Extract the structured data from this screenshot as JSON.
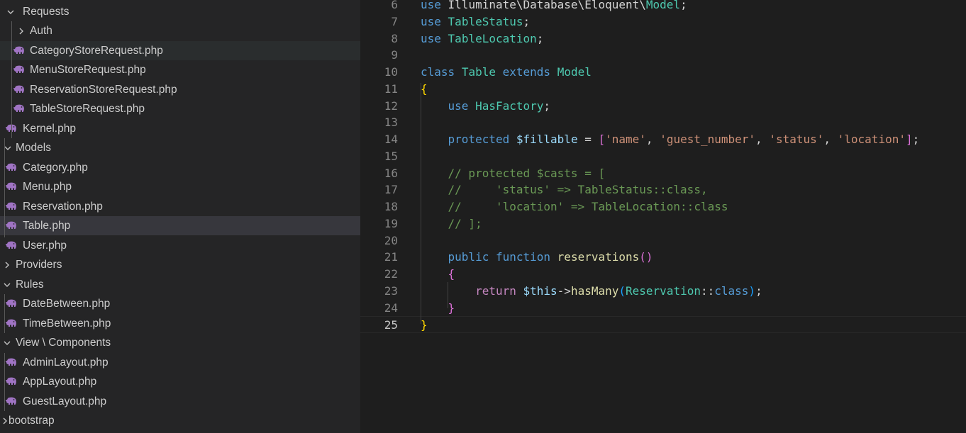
{
  "explorer": {
    "items": [
      {
        "label": "Requests",
        "type": "folder",
        "expanded": true,
        "icon": "chevron-down-icon"
      },
      {
        "label": "Auth",
        "type": "folder",
        "expanded": false,
        "icon": "chevron-right-icon"
      },
      {
        "label": "CategoryStoreRequest.php",
        "type": "file",
        "icon": "php-elephant-icon",
        "state": "hover"
      },
      {
        "label": "MenuStoreRequest.php",
        "type": "file",
        "icon": "php-elephant-icon"
      },
      {
        "label": "ReservationStoreRequest.php",
        "type": "file",
        "icon": "php-elephant-icon"
      },
      {
        "label": "TableStoreRequest.php",
        "type": "file",
        "icon": "php-elephant-icon"
      },
      {
        "label": "Kernel.php",
        "type": "file",
        "icon": "php-elephant-icon"
      },
      {
        "label": "Models",
        "type": "folder",
        "expanded": true,
        "icon": "chevron-down-icon"
      },
      {
        "label": "Category.php",
        "type": "file",
        "icon": "php-elephant-icon"
      },
      {
        "label": "Menu.php",
        "type": "file",
        "icon": "php-elephant-icon"
      },
      {
        "label": "Reservation.php",
        "type": "file",
        "icon": "php-elephant-icon"
      },
      {
        "label": "Table.php",
        "type": "file",
        "icon": "php-elephant-icon",
        "state": "selected"
      },
      {
        "label": "User.php",
        "type": "file",
        "icon": "php-elephant-icon"
      },
      {
        "label": "Providers",
        "type": "folder",
        "expanded": false,
        "icon": "chevron-right-icon"
      },
      {
        "label": "Rules",
        "type": "folder",
        "expanded": true,
        "icon": "chevron-down-icon"
      },
      {
        "label": "DateBetween.php",
        "type": "file",
        "icon": "php-elephant-icon"
      },
      {
        "label": "TimeBetween.php",
        "type": "file",
        "icon": "php-elephant-icon"
      },
      {
        "label": "View \\ Components",
        "type": "folder",
        "expanded": true,
        "icon": "chevron-down-icon"
      },
      {
        "label": "AdminLayout.php",
        "type": "file",
        "icon": "php-elephant-icon"
      },
      {
        "label": "AppLayout.php",
        "type": "file",
        "icon": "php-elephant-icon"
      },
      {
        "label": "GuestLayout.php",
        "type": "file",
        "icon": "php-elephant-icon"
      },
      {
        "label": "bootstrap",
        "type": "folder",
        "expanded": false,
        "icon": "chevron-right-icon"
      }
    ]
  },
  "editor": {
    "current_line": 25,
    "lines": [
      {
        "n": "6",
        "tokens": [
          [
            "kw",
            "use"
          ],
          [
            "pl",
            " Illuminate\\Database\\Eloquent\\"
          ],
          [
            "ty",
            "Model"
          ],
          [
            "pl",
            ";"
          ]
        ]
      },
      {
        "n": "7",
        "tokens": [
          [
            "kw",
            "use"
          ],
          [
            "pl",
            " "
          ],
          [
            "ty",
            "TableStatus"
          ],
          [
            "pl",
            ";"
          ]
        ]
      },
      {
        "n": "8",
        "tokens": [
          [
            "kw",
            "use"
          ],
          [
            "pl",
            " "
          ],
          [
            "ty",
            "TableLocation"
          ],
          [
            "pl",
            ";"
          ]
        ]
      },
      {
        "n": "9",
        "tokens": []
      },
      {
        "n": "10",
        "tokens": [
          [
            "kw",
            "class"
          ],
          [
            "pl",
            " "
          ],
          [
            "ty",
            "Table"
          ],
          [
            "pl",
            " "
          ],
          [
            "kw",
            "extends"
          ],
          [
            "pl",
            " "
          ],
          [
            "ty",
            "Model"
          ]
        ]
      },
      {
        "n": "11",
        "tokens": [
          [
            "b1",
            "{"
          ]
        ]
      },
      {
        "n": "12",
        "tokens": [
          [
            "pl",
            "    "
          ],
          [
            "kw",
            "use"
          ],
          [
            "pl",
            " "
          ],
          [
            "ty",
            "HasFactory"
          ],
          [
            "pl",
            ";"
          ]
        ]
      },
      {
        "n": "13",
        "tokens": []
      },
      {
        "n": "14",
        "tokens": [
          [
            "pl",
            "    "
          ],
          [
            "kw",
            "protected"
          ],
          [
            "pl",
            " "
          ],
          [
            "var",
            "$fillable"
          ],
          [
            "pl",
            " = "
          ],
          [
            "b2",
            "["
          ],
          [
            "str",
            "'name'"
          ],
          [
            "pl",
            ", "
          ],
          [
            "str",
            "'guest_number'"
          ],
          [
            "pl",
            ", "
          ],
          [
            "str",
            "'status'"
          ],
          [
            "pl",
            ", "
          ],
          [
            "str",
            "'location'"
          ],
          [
            "b2",
            "]"
          ],
          [
            "pl",
            ";"
          ]
        ]
      },
      {
        "n": "15",
        "tokens": []
      },
      {
        "n": "16",
        "tokens": [
          [
            "pl",
            "    "
          ],
          [
            "cm",
            "// protected $casts = ["
          ]
        ]
      },
      {
        "n": "17",
        "tokens": [
          [
            "pl",
            "    "
          ],
          [
            "cm",
            "//     'status' => TableStatus::class,"
          ]
        ]
      },
      {
        "n": "18",
        "tokens": [
          [
            "pl",
            "    "
          ],
          [
            "cm",
            "//     'location' => TableLocation::class"
          ]
        ]
      },
      {
        "n": "19",
        "tokens": [
          [
            "pl",
            "    "
          ],
          [
            "cm",
            "// ];"
          ]
        ]
      },
      {
        "n": "20",
        "tokens": []
      },
      {
        "n": "21",
        "tokens": [
          [
            "pl",
            "    "
          ],
          [
            "kw",
            "public"
          ],
          [
            "pl",
            " "
          ],
          [
            "kw",
            "function"
          ],
          [
            "pl",
            " "
          ],
          [
            "fn",
            "reservations"
          ],
          [
            "b2",
            "()"
          ]
        ]
      },
      {
        "n": "22",
        "tokens": [
          [
            "pl",
            "    "
          ],
          [
            "b2",
            "{"
          ]
        ]
      },
      {
        "n": "23",
        "tokens": [
          [
            "pl",
            "        "
          ],
          [
            "ctl",
            "return"
          ],
          [
            "pl",
            " "
          ],
          [
            "var",
            "$this"
          ],
          [
            "pl",
            "->"
          ],
          [
            "fn",
            "hasMany"
          ],
          [
            "b3",
            "("
          ],
          [
            "ty",
            "Reservation"
          ],
          [
            "pl",
            "::"
          ],
          [
            "kw",
            "class"
          ],
          [
            "b3",
            ")"
          ],
          [
            "pl",
            ";"
          ]
        ]
      },
      {
        "n": "24",
        "tokens": [
          [
            "pl",
            "    "
          ],
          [
            "b2",
            "}"
          ]
        ]
      },
      {
        "n": "25",
        "tokens": [
          [
            "b1",
            "}"
          ]
        ]
      }
    ]
  },
  "colors": {
    "sidebar_bg": "#252526",
    "editor_bg": "#1e1e1e",
    "selected_row": "#37373d",
    "hover_row": "#2a2d2e",
    "php_icon": "#a074c4"
  }
}
